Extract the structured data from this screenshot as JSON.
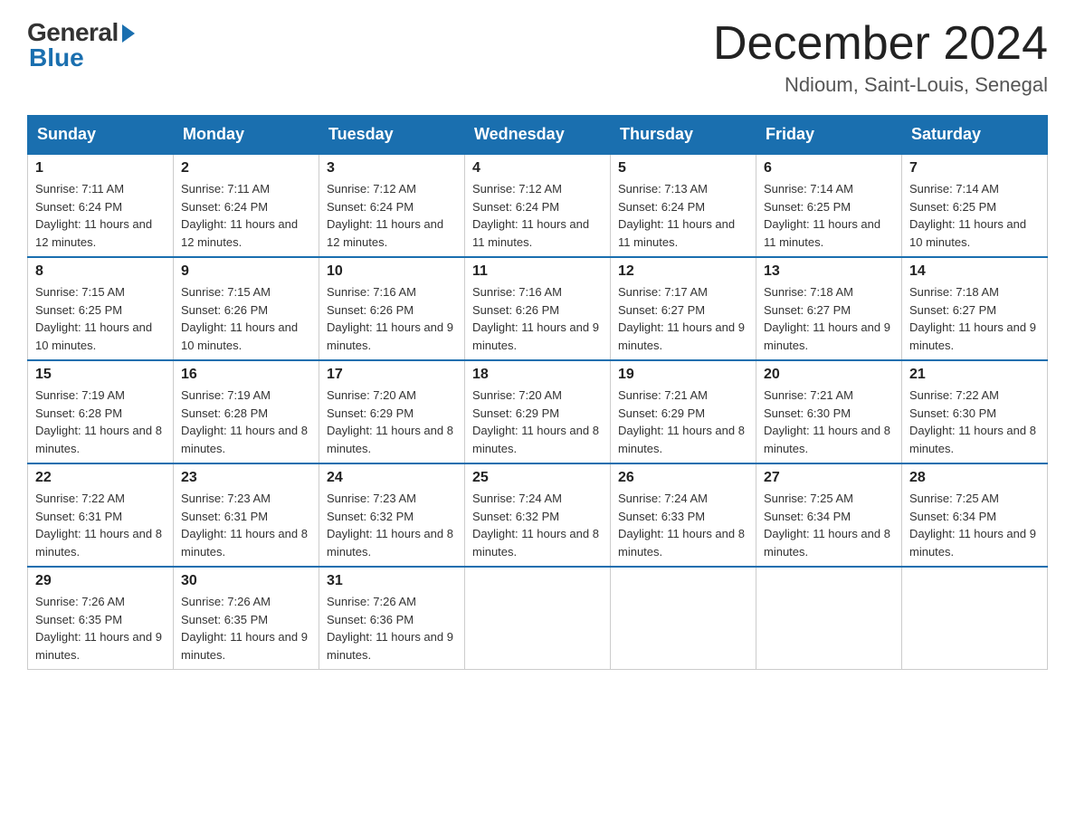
{
  "header": {
    "logo_general": "General",
    "logo_blue": "Blue",
    "month_title": "December 2024",
    "location": "Ndioum, Saint-Louis, Senegal"
  },
  "days_of_week": [
    "Sunday",
    "Monday",
    "Tuesday",
    "Wednesday",
    "Thursday",
    "Friday",
    "Saturday"
  ],
  "weeks": [
    [
      {
        "day": "1",
        "sunrise": "7:11 AM",
        "sunset": "6:24 PM",
        "daylight": "11 hours and 12 minutes."
      },
      {
        "day": "2",
        "sunrise": "7:11 AM",
        "sunset": "6:24 PM",
        "daylight": "11 hours and 12 minutes."
      },
      {
        "day": "3",
        "sunrise": "7:12 AM",
        "sunset": "6:24 PM",
        "daylight": "11 hours and 12 minutes."
      },
      {
        "day": "4",
        "sunrise": "7:12 AM",
        "sunset": "6:24 PM",
        "daylight": "11 hours and 11 minutes."
      },
      {
        "day": "5",
        "sunrise": "7:13 AM",
        "sunset": "6:24 PM",
        "daylight": "11 hours and 11 minutes."
      },
      {
        "day": "6",
        "sunrise": "7:14 AM",
        "sunset": "6:25 PM",
        "daylight": "11 hours and 11 minutes."
      },
      {
        "day": "7",
        "sunrise": "7:14 AM",
        "sunset": "6:25 PM",
        "daylight": "11 hours and 10 minutes."
      }
    ],
    [
      {
        "day": "8",
        "sunrise": "7:15 AM",
        "sunset": "6:25 PM",
        "daylight": "11 hours and 10 minutes."
      },
      {
        "day": "9",
        "sunrise": "7:15 AM",
        "sunset": "6:26 PM",
        "daylight": "11 hours and 10 minutes."
      },
      {
        "day": "10",
        "sunrise": "7:16 AM",
        "sunset": "6:26 PM",
        "daylight": "11 hours and 9 minutes."
      },
      {
        "day": "11",
        "sunrise": "7:16 AM",
        "sunset": "6:26 PM",
        "daylight": "11 hours and 9 minutes."
      },
      {
        "day": "12",
        "sunrise": "7:17 AM",
        "sunset": "6:27 PM",
        "daylight": "11 hours and 9 minutes."
      },
      {
        "day": "13",
        "sunrise": "7:18 AM",
        "sunset": "6:27 PM",
        "daylight": "11 hours and 9 minutes."
      },
      {
        "day": "14",
        "sunrise": "7:18 AM",
        "sunset": "6:27 PM",
        "daylight": "11 hours and 9 minutes."
      }
    ],
    [
      {
        "day": "15",
        "sunrise": "7:19 AM",
        "sunset": "6:28 PM",
        "daylight": "11 hours and 8 minutes."
      },
      {
        "day": "16",
        "sunrise": "7:19 AM",
        "sunset": "6:28 PM",
        "daylight": "11 hours and 8 minutes."
      },
      {
        "day": "17",
        "sunrise": "7:20 AM",
        "sunset": "6:29 PM",
        "daylight": "11 hours and 8 minutes."
      },
      {
        "day": "18",
        "sunrise": "7:20 AM",
        "sunset": "6:29 PM",
        "daylight": "11 hours and 8 minutes."
      },
      {
        "day": "19",
        "sunrise": "7:21 AM",
        "sunset": "6:29 PM",
        "daylight": "11 hours and 8 minutes."
      },
      {
        "day": "20",
        "sunrise": "7:21 AM",
        "sunset": "6:30 PM",
        "daylight": "11 hours and 8 minutes."
      },
      {
        "day": "21",
        "sunrise": "7:22 AM",
        "sunset": "6:30 PM",
        "daylight": "11 hours and 8 minutes."
      }
    ],
    [
      {
        "day": "22",
        "sunrise": "7:22 AM",
        "sunset": "6:31 PM",
        "daylight": "11 hours and 8 minutes."
      },
      {
        "day": "23",
        "sunrise": "7:23 AM",
        "sunset": "6:31 PM",
        "daylight": "11 hours and 8 minutes."
      },
      {
        "day": "24",
        "sunrise": "7:23 AM",
        "sunset": "6:32 PM",
        "daylight": "11 hours and 8 minutes."
      },
      {
        "day": "25",
        "sunrise": "7:24 AM",
        "sunset": "6:32 PM",
        "daylight": "11 hours and 8 minutes."
      },
      {
        "day": "26",
        "sunrise": "7:24 AM",
        "sunset": "6:33 PM",
        "daylight": "11 hours and 8 minutes."
      },
      {
        "day": "27",
        "sunrise": "7:25 AM",
        "sunset": "6:34 PM",
        "daylight": "11 hours and 8 minutes."
      },
      {
        "day": "28",
        "sunrise": "7:25 AM",
        "sunset": "6:34 PM",
        "daylight": "11 hours and 9 minutes."
      }
    ],
    [
      {
        "day": "29",
        "sunrise": "7:26 AM",
        "sunset": "6:35 PM",
        "daylight": "11 hours and 9 minutes."
      },
      {
        "day": "30",
        "sunrise": "7:26 AM",
        "sunset": "6:35 PM",
        "daylight": "11 hours and 9 minutes."
      },
      {
        "day": "31",
        "sunrise": "7:26 AM",
        "sunset": "6:36 PM",
        "daylight": "11 hours and 9 minutes."
      },
      null,
      null,
      null,
      null
    ]
  ]
}
